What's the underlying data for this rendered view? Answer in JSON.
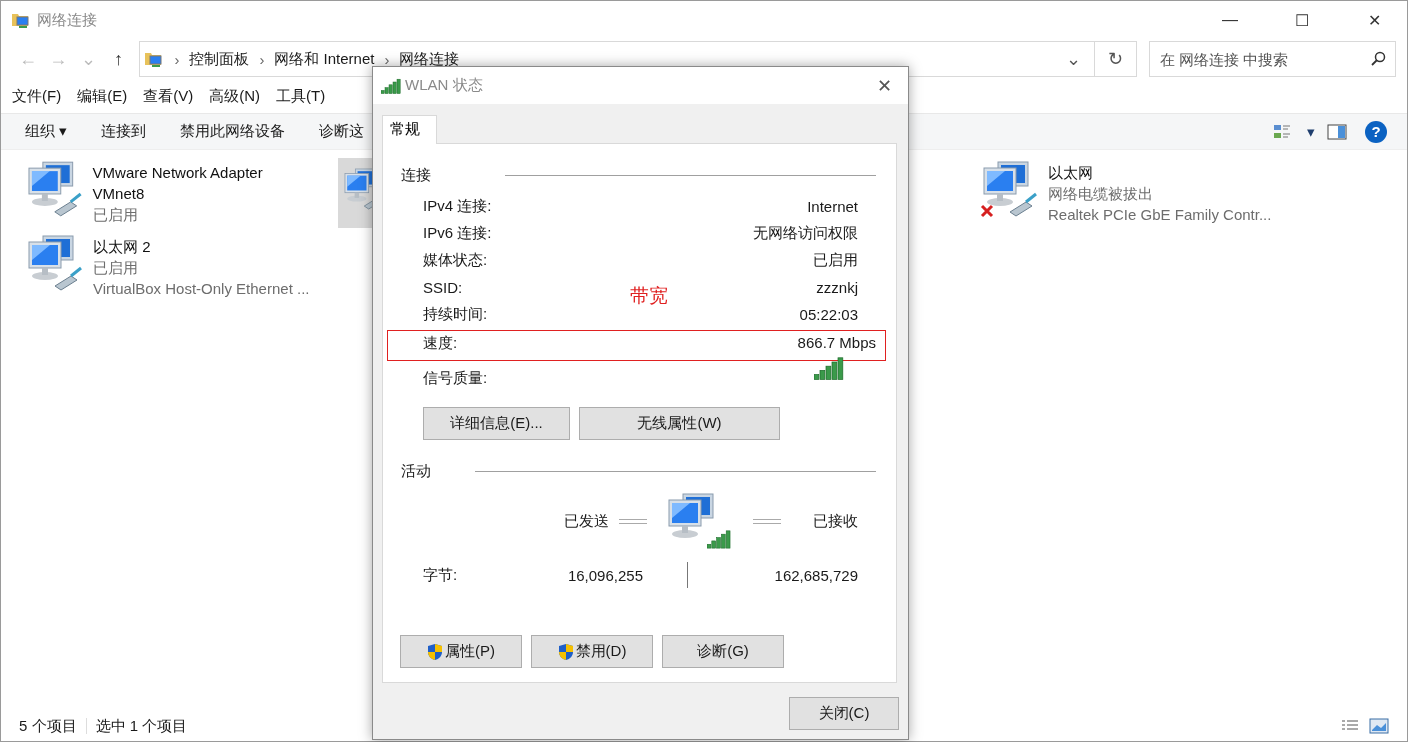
{
  "window": {
    "title": "网络连接",
    "controls": [
      "—",
      "☐",
      "✕"
    ]
  },
  "address_bar": {
    "nav": [
      "←",
      "→",
      "⌄",
      "↑"
    ],
    "breadcrumbs": [
      "控制面板",
      "网络和 Internet",
      "网络连接"
    ],
    "separator": "›",
    "dropdown": "⌄",
    "refresh": "↻",
    "search_placeholder": "在 网络连接 中搜索"
  },
  "menu": [
    "文件(F)",
    "编辑(E)",
    "查看(V)",
    "高级(N)",
    "工具(T)"
  ],
  "command_bar": {
    "items": [
      {
        "label": "组织",
        "caret": "▾"
      },
      {
        "label": "连接到"
      },
      {
        "label": "禁用此网络设备"
      },
      {
        "label": "诊断这"
      }
    ],
    "view_caret": "▾",
    "help": "?"
  },
  "connections": [
    {
      "name": "VMware Network Adapter VMnet8",
      "status": "已启用",
      "selected": false,
      "disconnected": false
    },
    {
      "selected": true,
      "disconnected": false
    },
    {
      "name": "以太网",
      "status": "网络电缆被拔出",
      "device": "Realtek PCIe GbE Family Contr...",
      "selected": false,
      "disconnected": true
    },
    {
      "name": "以太网 2",
      "status": "已启用",
      "device": "VirtualBox Host-Only Ethernet ...",
      "selected": false,
      "disconnected": false
    }
  ],
  "status_bar": {
    "count": "5 个项目",
    "selection": "选中 1 个项目"
  },
  "dialog": {
    "title": "WLAN 状态",
    "close": "✕",
    "tabs": [
      {
        "label": "常规",
        "selected": true
      }
    ],
    "connection_group": {
      "title": "连接",
      "rows": [
        {
          "kind": "text",
          "label": "IPv4 连接:",
          "value": "Internet",
          "highlighted": false
        },
        {
          "kind": "text",
          "label": "IPv6 连接:",
          "value": "无网络访问权限",
          "highlighted": false
        },
        {
          "kind": "text",
          "label": "媒体状态:",
          "value": "已启用",
          "highlighted": false
        },
        {
          "kind": "text",
          "label": "SSID:",
          "value": "zzznkj",
          "highlighted": false
        },
        {
          "kind": "text",
          "label": "持续时间:",
          "value": "05:22:03",
          "highlighted": false
        },
        {
          "kind": "text",
          "label": "速度:",
          "value": "866.7 Mbps",
          "highlighted": true
        },
        {
          "kind": "signal",
          "label": "信号质量:",
          "highlighted": false
        }
      ],
      "buttons": [
        "详细信息(E)...",
        "无线属性(W)"
      ]
    },
    "annotation": "带宽",
    "activity_group": {
      "title": "活动",
      "sent_label": "已发送",
      "received_label": "已接收",
      "bytes_label": "字节:",
      "bytes_sent": "16,096,255",
      "bytes_received": "162,685,729"
    },
    "actions": [
      {
        "label": "属性(P)",
        "shield": true
      },
      {
        "label": "禁用(D)",
        "shield": true
      },
      {
        "label": "诊断(G)",
        "shield": false
      }
    ],
    "close_button": "关闭(C)"
  }
}
